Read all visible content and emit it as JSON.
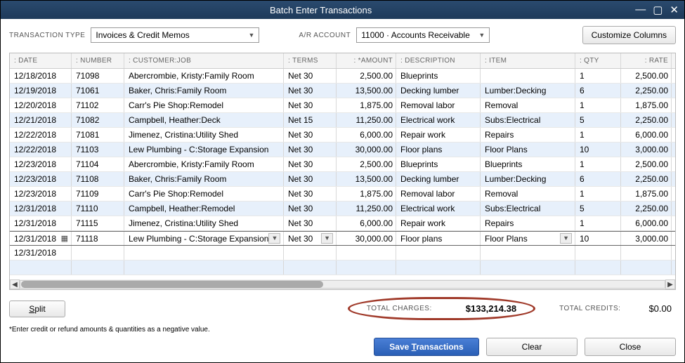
{
  "window": {
    "title": "Batch Enter Transactions"
  },
  "topbar": {
    "type_label": "TRANSACTION TYPE",
    "type_value": "Invoices & Credit Memos",
    "ar_label": "A/R ACCOUNT",
    "ar_value": "11000 · Accounts Receivable",
    "customize_label": "Customize Columns"
  },
  "columns": {
    "date": "DATE",
    "number": "NUMBER",
    "customer": "CUSTOMER:JOB",
    "terms": "TERMS",
    "amount": "*AMOUNT",
    "description": "DESCRIPTION",
    "item": "ITEM",
    "qty": "QTY",
    "rate": "RATE"
  },
  "rows": [
    {
      "date": "12/18/2018",
      "number": "71098",
      "customer": "Abercrombie, Kristy:Family Room",
      "terms": "Net 30",
      "amount": "2,500.00",
      "description": "Blueprints",
      "item": "",
      "qty": "1",
      "rate": "2,500.00"
    },
    {
      "date": "12/19/2018",
      "number": "71061",
      "customer": "Baker, Chris:Family Room",
      "terms": "Net 30",
      "amount": "13,500.00",
      "description": "Decking lumber",
      "item": "Lumber:Decking",
      "qty": "6",
      "rate": "2,250.00"
    },
    {
      "date": "12/20/2018",
      "number": "71102",
      "customer": "Carr's Pie Shop:Remodel",
      "terms": "Net 30",
      "amount": "1,875.00",
      "description": "Removal labor",
      "item": "Removal",
      "qty": "1",
      "rate": "1,875.00"
    },
    {
      "date": "12/21/2018",
      "number": "71082",
      "customer": "Campbell, Heather:Deck",
      "terms": "Net 15",
      "amount": "11,250.00",
      "description": "Electrical work",
      "item": "Subs:Electrical",
      "qty": "5",
      "rate": "2,250.00"
    },
    {
      "date": "12/22/2018",
      "number": "71081",
      "customer": "Jimenez, Cristina:Utility Shed",
      "terms": "Net 30",
      "amount": "6,000.00",
      "description": "Repair work",
      "item": "Repairs",
      "qty": "1",
      "rate": "6,000.00"
    },
    {
      "date": "12/22/2018",
      "number": "71103",
      "customer": "Lew Plumbing - C:Storage Expansion",
      "terms": "Net 30",
      "amount": "30,000.00",
      "description": "Floor plans",
      "item": "Floor Plans",
      "qty": "10",
      "rate": "3,000.00"
    },
    {
      "date": "12/23/2018",
      "number": "71104",
      "customer": "Abercrombie, Kristy:Family Room",
      "terms": "Net 30",
      "amount": "2,500.00",
      "description": "Blueprints",
      "item": "Blueprints",
      "qty": "1",
      "rate": "2,500.00"
    },
    {
      "date": "12/23/2018",
      "number": "71108",
      "customer": "Baker, Chris:Family Room",
      "terms": "Net 30",
      "amount": "13,500.00",
      "description": "Decking lumber",
      "item": "Lumber:Decking",
      "qty": "6",
      "rate": "2,250.00"
    },
    {
      "date": "12/23/2018",
      "number": "71109",
      "customer": "Carr's Pie Shop:Remodel",
      "terms": "Net 30",
      "amount": "1,875.00",
      "description": "Removal labor",
      "item": "Removal",
      "qty": "1",
      "rate": "1,875.00"
    },
    {
      "date": "12/31/2018",
      "number": "71110",
      "customer": "Campbell, Heather:Remodel",
      "terms": "Net 30",
      "amount": "11,250.00",
      "description": "Electrical work",
      "item": "Subs:Electrical",
      "qty": "5",
      "rate": "2,250.00"
    },
    {
      "date": "12/31/2018",
      "number": "71115",
      "customer": "Jimenez, Cristina:Utility Shed",
      "terms": "Net 30",
      "amount": "6,000.00",
      "description": "Repair work",
      "item": "Repairs",
      "qty": "1",
      "rate": "6,000.00"
    },
    {
      "date": "12/31/2018",
      "number": "71118",
      "customer": "Lew Plumbing - C:Storage Expansion",
      "terms": "Net 30",
      "amount": "30,000.00",
      "description": "Floor plans",
      "item": "Floor Plans",
      "qty": "10",
      "rate": "3,000.00",
      "active": true
    },
    {
      "date": "12/31/2018",
      "number": "",
      "customer": "",
      "terms": "",
      "amount": "",
      "description": "",
      "item": "",
      "qty": "",
      "rate": ""
    },
    {
      "date": "",
      "number": "",
      "customer": "",
      "terms": "",
      "amount": "",
      "description": "",
      "item": "",
      "qty": "",
      "rate": ""
    }
  ],
  "below": {
    "split_label": "Split",
    "total_charges_label": "TOTAL CHARGES:",
    "total_charges_value": "$133,214.38",
    "total_credits_label": "TOTAL CREDITS:",
    "total_credits_value": "$0.00",
    "note": "*Enter credit or refund amounts & quantities as a negative value."
  },
  "buttons": {
    "save": "Save Transactions",
    "clear": "Clear",
    "close": "Close"
  }
}
